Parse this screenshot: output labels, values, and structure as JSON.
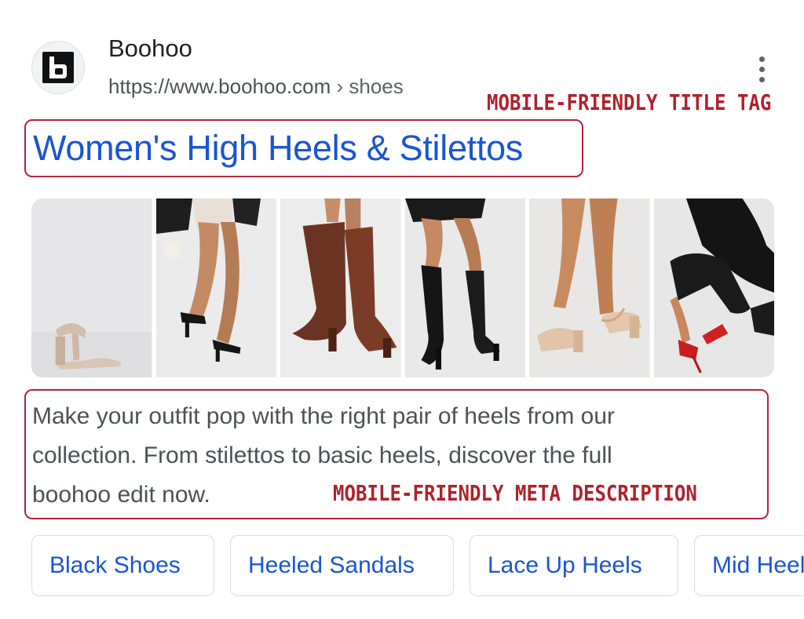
{
  "site": {
    "name": "Boohoo",
    "url": "https://www.boohoo.com",
    "breadcrumb": "› shoes",
    "favicon": "boohoo-b-logo"
  },
  "more_menu": {
    "icon": "more-vertical-icon"
  },
  "annotations": {
    "title_tag": "MOBILE-FRIENDLY TITLE TAG",
    "meta_description": "MOBILE-FRIENDLY META DESCRIPTION"
  },
  "result": {
    "title": "Women's High Heels & Stilettos",
    "snippet_lines": [
      "Make your outfit pop with the right pair of heels from our",
      "collection. From stilettos to basic heels, discover the full",
      "boohoo edit now."
    ]
  },
  "images": [
    {
      "name": "nude-block-heel-sandal"
    },
    {
      "name": "black-strappy-heel-sandals"
    },
    {
      "name": "brown-suede-knee-boots"
    },
    {
      "name": "black-leather-knee-boots"
    },
    {
      "name": "nude-block-heel-ankle-strap"
    },
    {
      "name": "red-stiletto-heels"
    }
  ],
  "chips": [
    "Black Shoes",
    "Heeled Sandals",
    "Lace Up Heels",
    "Mid Heels"
  ],
  "colors": {
    "link_blue": "#1a55d2",
    "annotation_red": "#b0212a",
    "highlight_border": "#b0253a",
    "snippet_gray": "#4d5156"
  }
}
